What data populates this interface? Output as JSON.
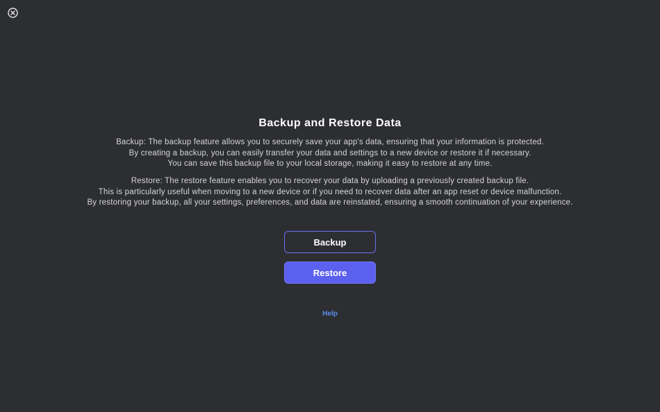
{
  "window": {
    "close_icon": "circle-x-icon"
  },
  "content": {
    "title": "Backup and Restore Data",
    "backup_description": [
      "Backup: The backup feature allows you to securely save your app's data, ensuring that your information is protected.",
      "By creating a backup, you can easily transfer your data and settings to a new device or restore it if necessary.",
      "You can save this backup file to your local storage, making it easy to restore at any time."
    ],
    "restore_description": [
      "Restore: The restore feature enables you to recover your data by uploading a previously created backup file.",
      "This is particularly useful when moving to a new device or if you need to recover data after an app reset or device malfunction.",
      "By restoring your backup, all your settings, preferences, and data are reinstated, ensuring a smooth continuation of your experience."
    ]
  },
  "actions": {
    "backup_label": "Backup",
    "restore_label": "Restore",
    "help_label": "Help"
  },
  "colors": {
    "background": "#2d2e32",
    "accent": "#5b60ee",
    "link": "#5b8ff0"
  }
}
